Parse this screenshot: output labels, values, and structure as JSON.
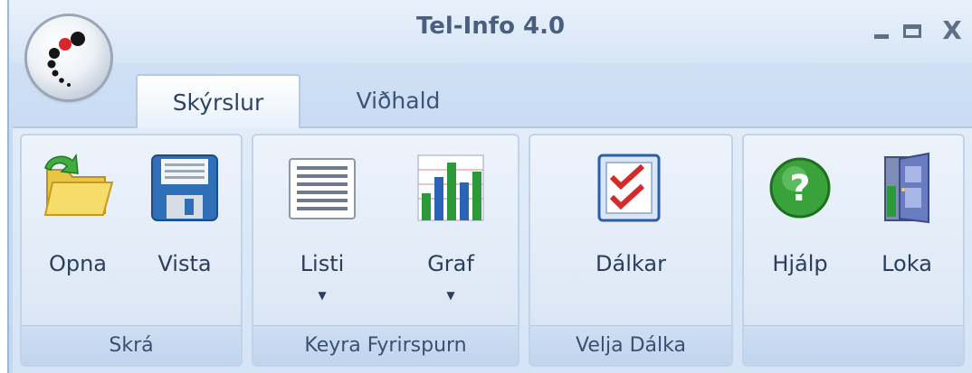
{
  "window": {
    "title": "Tel-Info 4.0",
    "controls": {
      "minimize": "minimize",
      "maximize": "maximize",
      "close": "X"
    }
  },
  "tabs": [
    {
      "label": "Skýrslur",
      "active": true
    },
    {
      "label": "Viðhald",
      "active": false
    }
  ],
  "groups": [
    {
      "label": "Skrá",
      "buttons": [
        {
          "label": "Opna",
          "icon": "folder-open-icon"
        },
        {
          "label": "Vista",
          "icon": "floppy-disk-icon"
        }
      ]
    },
    {
      "label": "Keyra Fyrirspurn",
      "buttons": [
        {
          "label": "Listi",
          "icon": "list-table-icon",
          "dropdown": true
        },
        {
          "label": "Graf",
          "icon": "bar-chart-icon",
          "dropdown": true
        }
      ]
    },
    {
      "label": "Velja Dálka",
      "buttons": [
        {
          "label": "Dálkar",
          "icon": "checklist-icon"
        }
      ]
    },
    {
      "label": "",
      "buttons": [
        {
          "label": "Hjálp",
          "icon": "help-icon"
        },
        {
          "label": "Loka",
          "icon": "exit-door-icon"
        }
      ]
    }
  ],
  "colors": {
    "ribbon_bg": "#dfe9f6",
    "group_border": "#c0d3ea",
    "text": "#2a3e5e",
    "accent_green": "#3aa23a",
    "accent_red": "#d42a2a"
  }
}
